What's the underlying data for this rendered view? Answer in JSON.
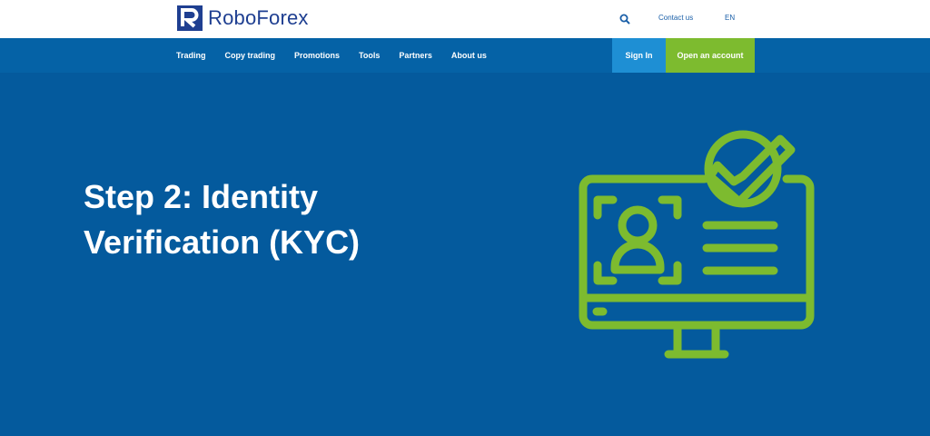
{
  "header": {
    "logo_text": "RoboForex",
    "contact_label": "Contact us",
    "language_label": "EN",
    "icons": {
      "search": "search-icon",
      "logo": "roboforex-logo-mark"
    }
  },
  "nav": {
    "items": [
      {
        "label": "Trading"
      },
      {
        "label": "Copy trading"
      },
      {
        "label": "Promotions"
      },
      {
        "label": "Tools"
      },
      {
        "label": "Partners"
      },
      {
        "label": "About us"
      }
    ],
    "signin_label": "Sign In",
    "open_account_label": "Open an account"
  },
  "hero": {
    "title_line1": "Step 2: Identity",
    "title_line2": "Verification (KYC)",
    "illustration": "identity-verification-monitor-icon"
  },
  "colors": {
    "brand": "#1f3f91",
    "nav_bg": "#0562a6",
    "hero_bg": "#045a9d",
    "sign_in": "#1e8fd4",
    "open_account": "#7dbb2f",
    "illustration": "#7dbb2f"
  }
}
